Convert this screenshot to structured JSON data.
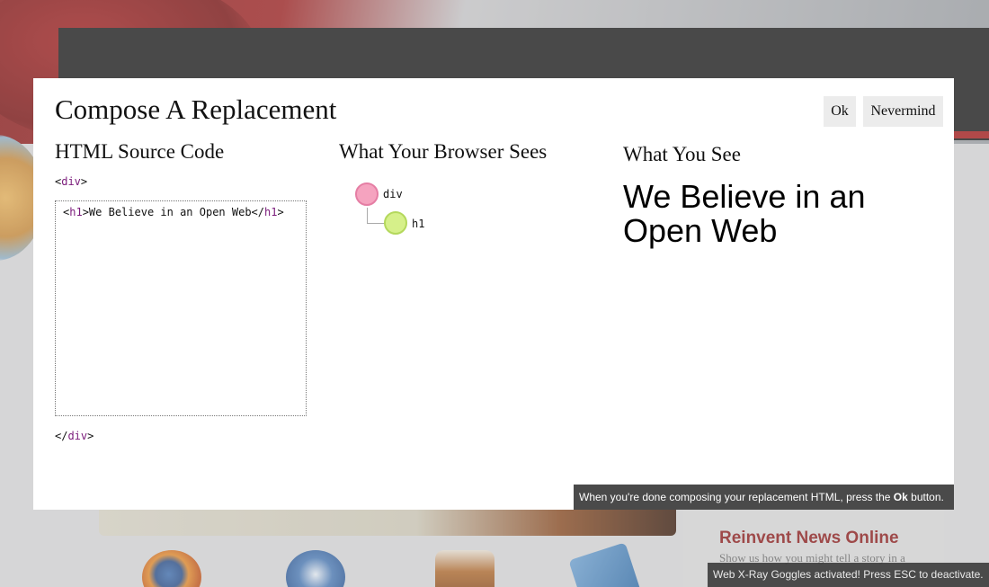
{
  "background_page": {
    "sidebar_heading": "Reinvent News Online",
    "sidebar_subtext": "Show us how you might tell a story in a",
    "icons": [
      "firefox-icon",
      "thunderbird-icon",
      "seamonkey-icon",
      "bugzilla-icon"
    ],
    "colors": {
      "brand_red": "#8c1b1b",
      "header_dark": "#1b1b1b"
    }
  },
  "modal": {
    "title": "Compose A Replacement",
    "buttons": {
      "ok": "Ok",
      "nevermind": "Nevermind"
    },
    "columns": {
      "source": {
        "heading": "HTML Source Code",
        "wrapper_open": {
          "lt": "<",
          "tag": "div",
          "gt": ">"
        },
        "wrapper_close": {
          "lt": "</",
          "tag": "div",
          "gt": ">"
        },
        "code": {
          "open_lt": "<",
          "open_tag": "h1",
          "open_gt": ">",
          "text": "We Believe in an Open Web",
          "close_lt": "</",
          "close_tag": "h1",
          "close_gt": ">"
        }
      },
      "browser": {
        "heading": "What Your Browser Sees",
        "tree": [
          {
            "label": "div",
            "color": "#f5a3bf"
          },
          {
            "label": "h1",
            "color": "#d6f08a"
          }
        ]
      },
      "preview": {
        "heading": "What You See",
        "content": "We Believe in an Open Web"
      }
    }
  },
  "hint": {
    "before": "When you're done composing your replacement HTML, press the ",
    "bold": "Ok",
    "after": " button."
  },
  "goggles_status": "Web X-Ray Goggles activated! Press ESC to deactivate."
}
